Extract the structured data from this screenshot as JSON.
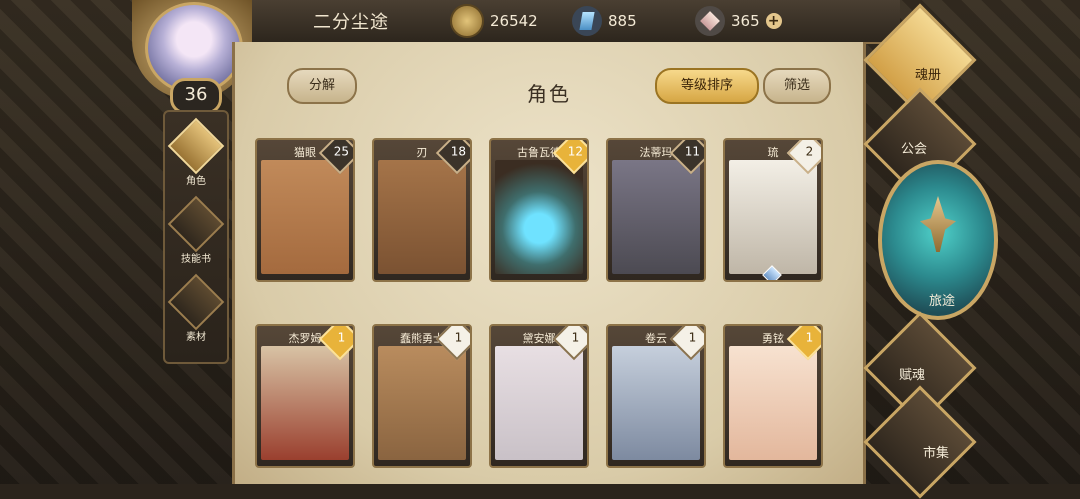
{
  "player": {
    "name": "二分尘途",
    "level": "36"
  },
  "resources": {
    "coins": "26542",
    "gems": "885",
    "crystals": "365"
  },
  "left_menu": [
    {
      "label": "角色",
      "active": true
    },
    {
      "label": "技能书",
      "active": false
    },
    {
      "label": "素材",
      "active": false
    }
  ],
  "panel": {
    "title": "角色",
    "decompose_label": "分解",
    "sort_label": "等级排序",
    "filter_label": "筛选"
  },
  "heroes": [
    {
      "name": "猫眼",
      "level": "25",
      "badge": "dark",
      "color": "#a46a3e"
    },
    {
      "name": "刃",
      "level": "18",
      "badge": "dark",
      "color": "#7b5232"
    },
    {
      "name": "古鲁瓦德",
      "level": "12",
      "badge": "gold",
      "color": "#3f6e6d"
    },
    {
      "name": "法蒂玛",
      "level": "11",
      "badge": "dark",
      "color": "#4c4a52"
    },
    {
      "name": "琉",
      "level": "2",
      "badge": "white",
      "color": "#d7d0c3"
    },
    {
      "name": "杰罗姆",
      "level": "1",
      "badge": "gold",
      "color": "#9a3f2e"
    },
    {
      "name": "蠢熊勇士",
      "level": "1",
      "badge": "silver",
      "color": "#8a6440"
    },
    {
      "name": "黛安娜",
      "level": "1",
      "badge": "silver",
      "color": "#c9c1c7"
    },
    {
      "name": "卷云",
      "level": "1",
      "badge": "silver",
      "color": "#7d8aa0"
    },
    {
      "name": "勇铉",
      "level": "1",
      "badge": "gold",
      "color": "#e3b79c"
    }
  ],
  "right_menu": {
    "soul_book": "魂册",
    "guild": "公会",
    "journey": "旅途",
    "talent": "赋魂",
    "market": "市集"
  }
}
